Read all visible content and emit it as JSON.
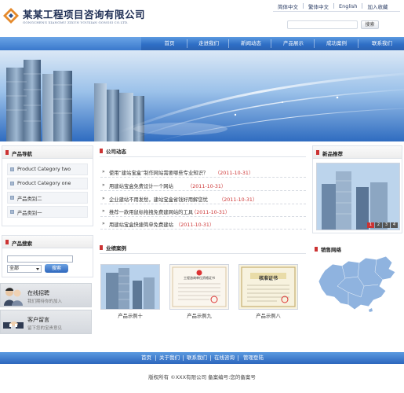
{
  "header": {
    "company_name": "某某工程项目咨询有限公司",
    "company_pinyin": "GONGCHENG XIANGMU ZIXUN YOUXIAN GONGSI CO.LTD.",
    "top_links": [
      "简体中文",
      "繁体中文",
      "English",
      "加入收藏"
    ],
    "search_button": "搜索"
  },
  "nav": {
    "items": [
      "首页",
      "走进我们",
      "新闻动态",
      "产品展示",
      "成功案例",
      "联系我们"
    ]
  },
  "left": {
    "product_nav_title": "产品导航",
    "categories": [
      "Product Category two",
      "Product Category one",
      "产品类别二",
      "产品类别一"
    ],
    "product_search_title": "产品搜索",
    "search_select_value": "全部",
    "search_button": "搜索",
    "promo_jobs": {
      "title": "在线招聘",
      "subtitle": "我们期待你的加入"
    },
    "promo_message": {
      "title": "客户留言",
      "subtitle": "留下您的宝贵意见"
    }
  },
  "center": {
    "news_title": "公司动态",
    "news": [
      {
        "title": "使用“建站宝盒”制作网站需要哪些专业知识？",
        "date": "（2011-10-31）"
      },
      {
        "title": "用建站宝盒免费设计一个网站",
        "date": "（2011-10-31）"
      },
      {
        "title": "企业建站不用发愁，建站宝盒省钱好用解您忧",
        "date": "（2011-10-31）"
      },
      {
        "title": "推荐一款用鼠标拖拽免费建网站的工具",
        "date": "（2011-10-31）"
      },
      {
        "title": "用建站宝盒快捷简单免费建站",
        "date": "（2011-10-31）"
      }
    ],
    "cases_title": "业绩案例",
    "cases": [
      {
        "caption": "产品示例十",
        "cert_title": ""
      },
      {
        "caption": "产品示例九",
        "cert_title": "工程咨询单位资格证书"
      },
      {
        "caption": "产品示例八",
        "cert_title": "核准证书"
      }
    ]
  },
  "right": {
    "new_products_title": "新品推荐",
    "pager": [
      "1",
      "2",
      "3",
      "4"
    ],
    "sales_network_title": "销售网络"
  },
  "footer": {
    "links": [
      "首页",
      "关于我们",
      "联系我们",
      "在线咨询",
      "管理登陆"
    ],
    "copyright": "版权所有 ©XXX有限公司 备案编号:您的备案号"
  },
  "colors": {
    "nav_blue": "#2f6fc6",
    "accent_red": "#cc3333",
    "title_navy": "#1f2f55"
  }
}
